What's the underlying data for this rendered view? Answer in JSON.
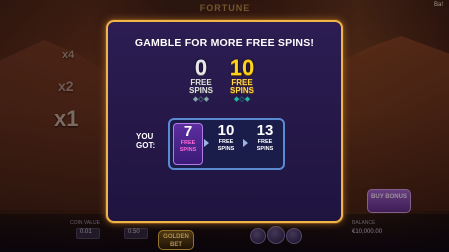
{
  "game": {
    "logo_text": "FORTUNE",
    "corner_label": "Ba!"
  },
  "multipliers": [
    "x4",
    "x2",
    "x1"
  ],
  "bottom_bar": {
    "coin_value_label": "COIN VALUE",
    "coin_value": "0.01",
    "cash_bet_label": "CASH BET",
    "cash_bet": "0.50",
    "balance_label": "BALANCE",
    "balance": "€10,000.00",
    "golden_bet_label": "GOLDEN BET",
    "buy_bonus_label": "BUY BONUS"
  },
  "dialog": {
    "title": "GAMBLE FOR MORE FREE SPINS!",
    "badge_zero": {
      "number": "0",
      "word1": "FREE",
      "word2": "SPINS"
    },
    "badge_ten": {
      "number": "10",
      "word1": "FREE",
      "word2": "SPINS"
    },
    "you_got_line1": "YOU",
    "you_got_line2": "GOT:",
    "options": [
      {
        "number": "7",
        "word1": "FREE",
        "word2": "SPINS",
        "active": true
      },
      {
        "number": "10",
        "word1": "FREE",
        "word2": "SPINS",
        "active": false
      },
      {
        "number": "13",
        "word1": "FREE",
        "word2": "SPINS",
        "active": false
      }
    ]
  },
  "colors": {
    "dialog_border": "#f0b54a",
    "dialog_bg": "#2c1d52",
    "active_option_text": "#ff66d6",
    "gold_badge": "#ffd21a"
  }
}
